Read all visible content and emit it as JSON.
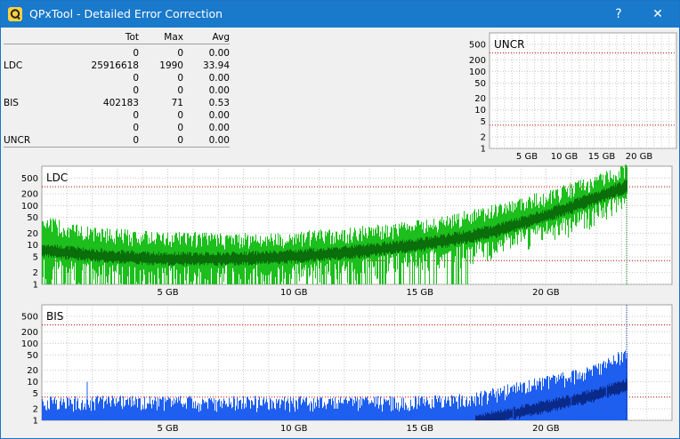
{
  "window": {
    "title": "QPxTool - Detailed Error Correction",
    "help_label": "?",
    "close_label": "✕"
  },
  "stats": {
    "headers": {
      "label": "",
      "tot": "Tot",
      "max": "Max",
      "avg": "Avg"
    },
    "rows": [
      {
        "label": "",
        "tot": "0",
        "max": "0",
        "avg": "0.00"
      },
      {
        "label": "LDC",
        "tot": "25916618",
        "max": "1990",
        "avg": "33.94"
      },
      {
        "label": "",
        "tot": "0",
        "max": "0",
        "avg": "0.00"
      },
      {
        "label": "",
        "tot": "0",
        "max": "0",
        "avg": "0.00"
      },
      {
        "label": "BIS",
        "tot": "402183",
        "max": "71",
        "avg": "0.53"
      },
      {
        "label": "",
        "tot": "0",
        "max": "0",
        "avg": "0.00"
      },
      {
        "label": "",
        "tot": "0",
        "max": "0",
        "avg": "0.00"
      },
      {
        "label": "UNCR",
        "tot": "0",
        "max": "0",
        "avg": "0.00"
      }
    ]
  },
  "colors": {
    "ldc_bright": "#1cbf1c",
    "ldc_dark": "#0a6e0a",
    "bis_bright": "#1e5ff0",
    "bis_dark": "#0a2a8a",
    "limit_red": "#c00000"
  },
  "chart_data": [
    {
      "type": "area",
      "title": "UNCR",
      "y_ticks": [
        "500",
        "200",
        "100",
        "50",
        "20",
        "10",
        "5",
        "2",
        "1"
      ],
      "x_ticks": [
        "5 GB",
        "10 GB",
        "15 GB",
        "20 GB"
      ],
      "x_unit": "GB",
      "xlim": [
        0,
        25
      ],
      "y_scale": "log",
      "ylim": [
        1,
        1000
      ],
      "series": [
        {
          "values_summary": "all zero"
        }
      ]
    },
    {
      "type": "area",
      "title": "LDC",
      "y_ticks": [
        "500",
        "200",
        "100",
        "50",
        "20",
        "10",
        "5",
        "2",
        "1"
      ],
      "x_ticks": [
        "5 GB",
        "10 GB",
        "15 GB",
        "20 GB"
      ],
      "xlim": [
        0,
        25
      ],
      "y_scale": "log",
      "ylim": [
        1,
        1000
      ],
      "end_gb": 23.2,
      "series": [
        {
          "kind": "max",
          "x": [
            0,
            1,
            2,
            3,
            4,
            5,
            6,
            7,
            8,
            9,
            10,
            11,
            12,
            13,
            14,
            15,
            16,
            17,
            18,
            19,
            20,
            21,
            22,
            23,
            23.2
          ],
          "y": [
            40,
            25,
            20,
            18,
            16,
            15,
            15,
            14,
            14,
            14,
            15,
            17,
            19,
            22,
            25,
            30,
            40,
            55,
            75,
            110,
            170,
            260,
            420,
            700,
            900
          ]
        },
        {
          "kind": "avg",
          "x": [
            0,
            1,
            2,
            3,
            4,
            5,
            6,
            7,
            8,
            9,
            10,
            11,
            12,
            13,
            14,
            15,
            16,
            17,
            18,
            19,
            20,
            21,
            22,
            23,
            23.2
          ],
          "y": [
            8,
            7,
            6,
            5.5,
            5,
            4.8,
            4.8,
            4.8,
            5,
            5.2,
            5.6,
            6.2,
            7,
            8,
            9.5,
            11,
            14,
            18,
            25,
            38,
            60,
            100,
            170,
            300,
            350
          ]
        },
        {
          "kind": "min",
          "x": [
            0,
            5,
            10,
            15,
            17.5,
            20,
            23.2
          ],
          "y": [
            1,
            1,
            1,
            1,
            2,
            5,
            20
          ]
        }
      ]
    },
    {
      "type": "area",
      "title": "BIS",
      "y_ticks": [
        "500",
        "200",
        "100",
        "50",
        "20",
        "10",
        "5",
        "2",
        "1"
      ],
      "x_ticks": [
        "5 GB",
        "10 GB",
        "15 GB",
        "20 GB"
      ],
      "xlim": [
        0,
        25
      ],
      "y_scale": "log",
      "ylim": [
        1,
        1000
      ],
      "end_gb": 23.2,
      "series": [
        {
          "kind": "max",
          "x": [
            0,
            2,
            4,
            6,
            8,
            10,
            12,
            14,
            16,
            17,
            18,
            19,
            20,
            21,
            22,
            23,
            23.2
          ],
          "y": [
            3,
            3,
            3,
            3,
            3,
            3,
            3,
            3,
            3.2,
            3.5,
            5,
            7,
            10,
            14,
            22,
            45,
            60
          ]
        },
        {
          "kind": "avg",
          "x": [
            0,
            17,
            18,
            19,
            20,
            21,
            22,
            23,
            23.2
          ],
          "y": [
            1,
            1,
            1.3,
            1.8,
            2.5,
            3.5,
            5,
            8,
            9
          ]
        },
        {
          "kind": "spikes",
          "x": [
            1.8,
            3.5,
            7.5,
            12.8,
            18.7,
            21.0,
            22.4
          ],
          "y": [
            10,
            4,
            3,
            3,
            4,
            7,
            20
          ]
        }
      ]
    }
  ]
}
